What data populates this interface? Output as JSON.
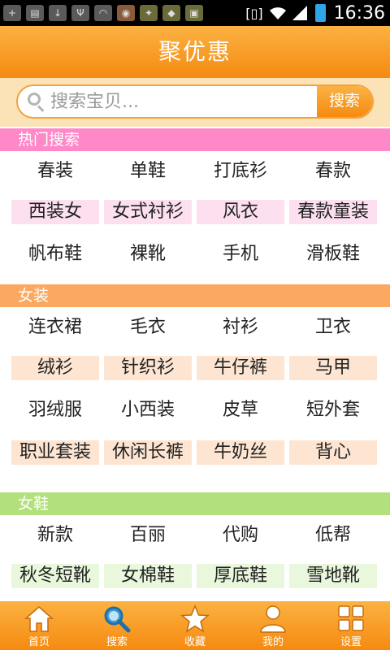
{
  "status_bar": {
    "time": "16:36",
    "left_icons": [
      "add-icon",
      "sim-icon",
      "download-icon",
      "usb-icon",
      "speedometer-icon",
      "app-icon",
      "android-icon",
      "chat-icon",
      "image-icon"
    ],
    "right_icons": [
      "vibrate-icon",
      "wifi-icon",
      "signal-icon",
      "battery-icon"
    ]
  },
  "header": {
    "title": "聚优惠"
  },
  "search": {
    "placeholder": "搜索宝贝...",
    "button_label": "搜索"
  },
  "colors": {
    "accent": "#f58a10",
    "hot_header": "#ff88c8",
    "hot_chip": "#fde0ef",
    "women_header": "#fba860",
    "women_chip": "#fde5d2",
    "shoes_header": "#b2e07c",
    "shoes_chip": "#e9f7dc"
  },
  "sections": [
    {
      "title": "热门搜索",
      "rows": [
        [
          "春装",
          "单鞋",
          "打底衫",
          "春款"
        ],
        [
          "西装女",
          "女式衬衫",
          "风衣",
          "春款童装"
        ],
        [
          "帆布鞋",
          "裸靴",
          "手机",
          "滑板鞋"
        ]
      ]
    },
    {
      "title": "女装",
      "rows": [
        [
          "连衣裙",
          "毛衣",
          "衬衫",
          "卫衣"
        ],
        [
          "绒衫",
          "针织衫",
          "牛仔裤",
          "马甲"
        ],
        [
          "羽绒服",
          "小西装",
          "皮草",
          "短外套"
        ],
        [
          "职业套装",
          "休闲长裤",
          "牛奶丝",
          "背心"
        ]
      ]
    },
    {
      "title": "女鞋",
      "rows": [
        [
          "新款",
          "百丽",
          "代购",
          "低帮"
        ],
        [
          "秋冬短靴",
          "女棉鞋",
          "厚底鞋",
          "雪地靴"
        ]
      ]
    }
  ],
  "nav": [
    {
      "label": "首页",
      "icon": "home-icon"
    },
    {
      "label": "搜索",
      "icon": "search-icon"
    },
    {
      "label": "收藏",
      "icon": "star-icon"
    },
    {
      "label": "我的",
      "icon": "user-icon"
    },
    {
      "label": "设置",
      "icon": "settings-grid-icon"
    }
  ]
}
